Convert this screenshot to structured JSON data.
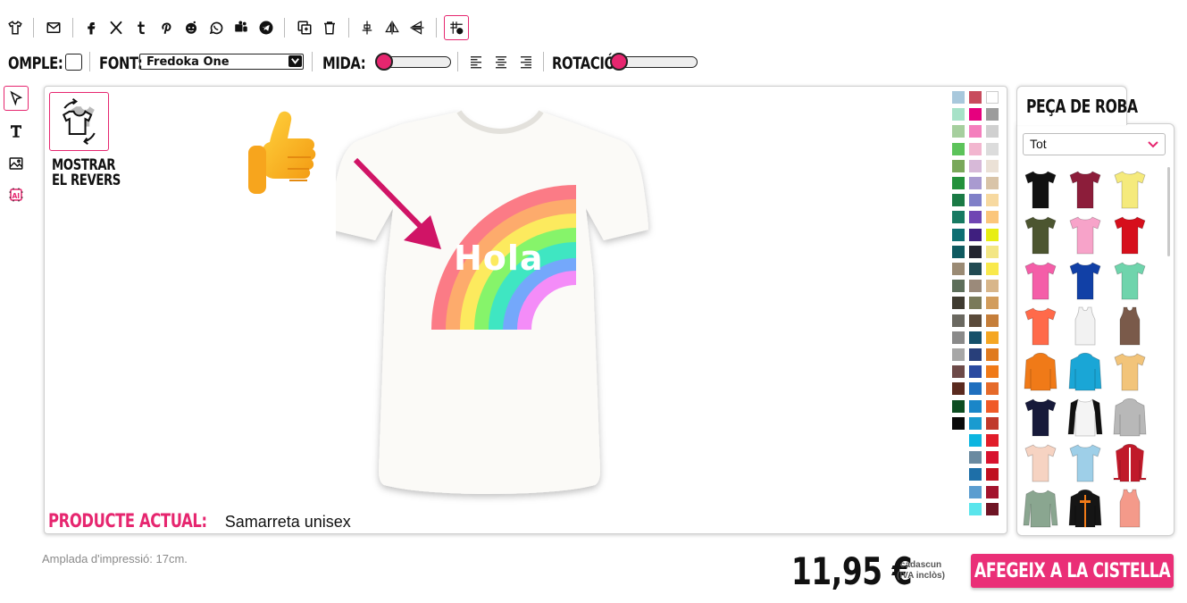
{
  "toolbar": {
    "icons": [
      "tshirt-icon",
      "email-icon",
      "facebook-icon",
      "x-icon",
      "tumblr-icon",
      "pinterest-icon",
      "reddit-icon",
      "whatsapp-icon",
      "teams-icon",
      "telegram-icon",
      "duplicate-icon",
      "trash-icon",
      "align-center-icon",
      "flip-horizontal-icon",
      "flip-vertical-icon",
      "grid-snap-icon"
    ]
  },
  "options": {
    "fill_label": "OMPLE:",
    "font_label": "FONT:",
    "font_value": "Fredoka One",
    "size_label": "MIDA:",
    "size_level": 0,
    "rotation_label": "ROTACIÓ:",
    "rotation_level": 0
  },
  "tools": [
    "select-tool-icon",
    "text-tool-icon",
    "image-tool-icon",
    "ai-tool-icon"
  ],
  "canvas": {
    "show_back_label_1": "MOSTRAR",
    "show_back_label_2": "EL REVERS",
    "design_text": "Hola",
    "current_product_label": "PRODUCTE ACTUAL:",
    "current_product_value": "Samarreta unisex"
  },
  "palette": {
    "col1": [
      "#a8c8dc",
      "#a7e2c8",
      "#a6cf9e",
      "#5cc35a",
      "#79a85a",
      "#23913b",
      "#1a7a45",
      "#177a62",
      "#0e6e72",
      "#0f5a60",
      "#9a8a74",
      "#5d6e5a",
      "#3f3b30",
      "#6a6860",
      "#8a8a8a",
      "#a7a7a7",
      "#6d4a48",
      "#5a2a1f",
      "#0d4d22",
      "#0a0a0a"
    ],
    "col2": [
      "#c84b5d",
      "#e6007e",
      "#f47fbd",
      "#f2b6cf",
      "#d7b9d8",
      "#a99ad0",
      "#8080c8",
      "#7045b3",
      "#3f1f7f",
      "#232530",
      "#214a52",
      "#9b8a7a",
      "#7a7a5a",
      "#5a4a3a",
      "#15506a",
      "#283f7a",
      "#2a4aa0",
      "#1f6fbe",
      "#1a86c8",
      "#1a9bd0",
      "#0db5e0",
      "#6a8aa0",
      "#1e6fa8",
      "#5b9dd0",
      "#5ae5ec"
    ],
    "col3": [
      "#ffffff",
      "#9c9c9c",
      "#d0d0d0",
      "#dcdcdc",
      "#ebe1d6",
      "#d9c4a8",
      "#f7d9a0",
      "#fbc67c",
      "#e8ee12",
      "#f3e684",
      "#f9e94c",
      "#d8b68a",
      "#d29d5c",
      "#c57e3a",
      "#f5a623",
      "#e07b1f",
      "#f07a18",
      "#e56a2a",
      "#f05a28",
      "#c0392b",
      "#e11d2a",
      "#d8122e",
      "#c01020",
      "#a3132d",
      "#6e1424"
    ]
  },
  "products": {
    "tab_label": "PEÇA DE ROBA",
    "filter_value": "Tot",
    "items": [
      {
        "name": "tshirt-black",
        "color": "#111111"
      },
      {
        "name": "tshirt-maroon",
        "color": "#8c1d3a"
      },
      {
        "name": "tshirt-yellow",
        "color": "#f5ea7c"
      },
      {
        "name": "tshirt-olive",
        "color": "#4c5530"
      },
      {
        "name": "tshirt-pink-women",
        "color": "#f7a3c9"
      },
      {
        "name": "tshirt-red",
        "color": "#d60f1c"
      },
      {
        "name": "tshirt-fuchsia-women",
        "color": "#f45ea8"
      },
      {
        "name": "tshirt-royal",
        "color": "#1140a6"
      },
      {
        "name": "tshirt-mint",
        "color": "#6fd4ac"
      },
      {
        "name": "tshirt-coral-women",
        "color": "#ff6a4a"
      },
      {
        "name": "tank-white",
        "color": "#f2f2f2"
      },
      {
        "name": "tank-brown",
        "color": "#7a5a4a"
      },
      {
        "name": "hoodie-orange",
        "color": "#f07a18"
      },
      {
        "name": "hoodie-turquoise",
        "color": "#1aa6d6"
      },
      {
        "name": "tshirt-tiedye",
        "color": "#f2c47a"
      },
      {
        "name": "tshirt-navy",
        "color": "#171a3a"
      },
      {
        "name": "raglan-white-black",
        "color": "#f4f4f4"
      },
      {
        "name": "hoodie-grey",
        "color": "#b8b8b8"
      },
      {
        "name": "tshirt-peach",
        "color": "#f6d3c2"
      },
      {
        "name": "tshirt-skyblue",
        "color": "#9ecfe8"
      },
      {
        "name": "jacket-red-white",
        "color": "#c01a2a"
      },
      {
        "name": "longsleeve-sage",
        "color": "#8aa690"
      },
      {
        "name": "hoodie-black-orange",
        "color": "#151515"
      },
      {
        "name": "tank-salmon",
        "color": "#f49a8a"
      }
    ]
  },
  "footer": {
    "print_width": "Amplada d'impressió: 17cm.",
    "price": "11,95 €",
    "price_note_1": "cadascun",
    "price_note_2": "(IVA inclòs)",
    "add_to_cart": "AFEGEIX A LA CISTELLA"
  },
  "colors": {
    "accent": "#e6266f",
    "border": "#cfcfcf"
  }
}
